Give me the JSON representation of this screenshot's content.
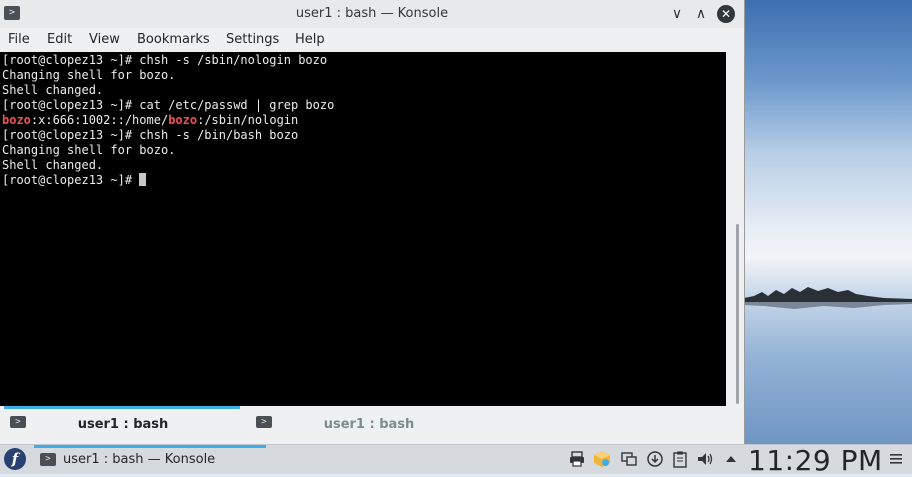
{
  "window": {
    "title": "user1 : bash — Konsole",
    "app_icon": "terminal-icon",
    "controls": {
      "minimize": "∨",
      "maximize": "∧",
      "close": "✕"
    }
  },
  "menu": {
    "items": [
      "File",
      "Edit",
      "View",
      "Bookmarks",
      "Settings",
      "Help"
    ]
  },
  "terminal": {
    "lines": [
      [
        {
          "t": "[root@clopez13 ~]# chsh -s /sbin/nologin bozo"
        }
      ],
      [
        {
          "t": "Changing shell for bozo."
        }
      ],
      [
        {
          "t": "Shell changed."
        }
      ],
      [
        {
          "t": "[root@clopez13 ~]# cat /etc/passwd | grep bozo"
        }
      ],
      [
        {
          "t": "bozo",
          "hl": true
        },
        {
          "t": ":x:666:1002::/home/"
        },
        {
          "t": "bozo",
          "hl": true
        },
        {
          "t": ":/sbin/nologin"
        }
      ],
      [
        {
          "t": "[root@clopez13 ~]# chsh -s /bin/bash bozo"
        }
      ],
      [
        {
          "t": "Changing shell for bozo."
        }
      ],
      [
        {
          "t": "Shell changed."
        }
      ],
      [
        {
          "t": "[root@clopez13 ~]# "
        }
      ]
    ],
    "colors": {
      "background": "#000000",
      "text": "#ececec",
      "highlight": "#f05159"
    }
  },
  "tabs": [
    {
      "label": "user1 : bash",
      "active": true
    },
    {
      "label": "user1 : bash",
      "active": false
    }
  ],
  "colors": {
    "accent": "#3daee9",
    "inactive_tab_text": "#7f8c8d",
    "active_tab_text": "#232629"
  },
  "taskbar": {
    "launcher_icon": "fedora-icon",
    "launcher_glyph": "f",
    "task_label": "user1 : bash — Konsole",
    "tray_icons": [
      "printer-icon",
      "package-updates-icon",
      "network-display-icon",
      "updates-icon",
      "clipboard-icon",
      "volume-icon",
      "tray-expand-icon"
    ],
    "clock": "11:29 PM",
    "menu_icon": "hamburger-menu-icon"
  }
}
